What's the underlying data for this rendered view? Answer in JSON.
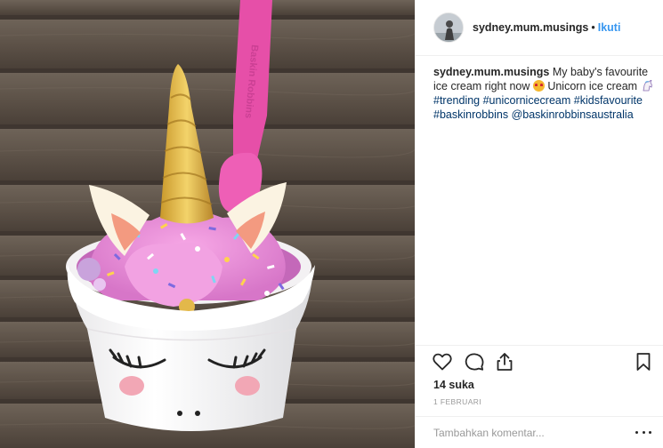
{
  "post": {
    "username": "sydney.mum.musings",
    "separator": "•",
    "follow_label": "Ikuti",
    "caption": {
      "username": "sydney.mum.musings",
      "text_1": " My baby's favourite ice cream right now ",
      "text_2": " Unicorn ice cream ",
      "hashtags": [
        "#trending",
        "#unicornicecream",
        "#kidsfavourite",
        "#baskinrobbins",
        "@baskinrobbinsaustralia"
      ],
      "emoji_1": "heart-eyes-emoji",
      "emoji_2": "unicorn-emoji"
    },
    "likes": "14 suka",
    "date": "1 FEBRUARI",
    "comment_placeholder": "Tambahkan komentar...",
    "icons": [
      "heart-icon",
      "comment-icon",
      "share-icon",
      "bookmark-icon",
      "more-options-icon"
    ],
    "photo_spoon_text": "Baskin Robbins"
  },
  "colors": {
    "follow": "#3897f0",
    "hashtag": "#003569",
    "border": "#efefef",
    "meta": "#999999"
  }
}
